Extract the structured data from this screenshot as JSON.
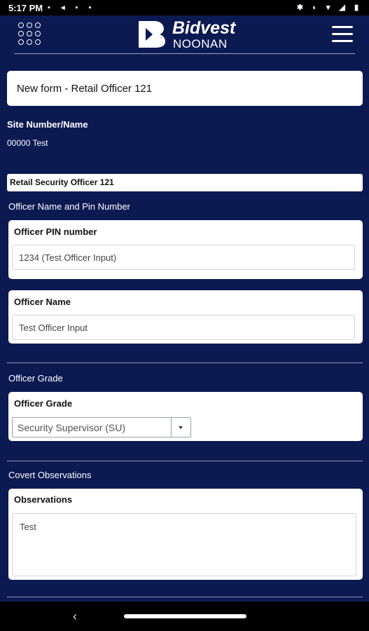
{
  "status_bar": {
    "time": "5:17 PM",
    "left_icons": "▪ ◂ ▪ ▪",
    "right_icons": "✱ ◐ ▾ ◢ ▮"
  },
  "brand": {
    "line1": "Bidvest",
    "line2": "NOONAN"
  },
  "form": {
    "title": "New form - Retail Officer 121",
    "site_label": "Site Number/Name",
    "site_value": "00000 Test",
    "section_title": "Retail Security Officer 121",
    "officer_group_label": "Officer Name and Pin Number",
    "pin": {
      "label": "Officer PIN number",
      "value": "1234 (Test Officer Input)"
    },
    "name": {
      "label": "Officer Name",
      "value": "Test Officer Input"
    },
    "grade_group_label": "Officer Grade",
    "grade": {
      "label": "Officer Grade",
      "selected": "Security Supervisor (SU)"
    },
    "covert_group_label": "Covert Observations",
    "observations": {
      "label": "Observations",
      "value": "Test"
    }
  },
  "nav": {
    "back": "‹"
  },
  "colors": {
    "background": "#0c1a52",
    "card": "#ffffff"
  }
}
